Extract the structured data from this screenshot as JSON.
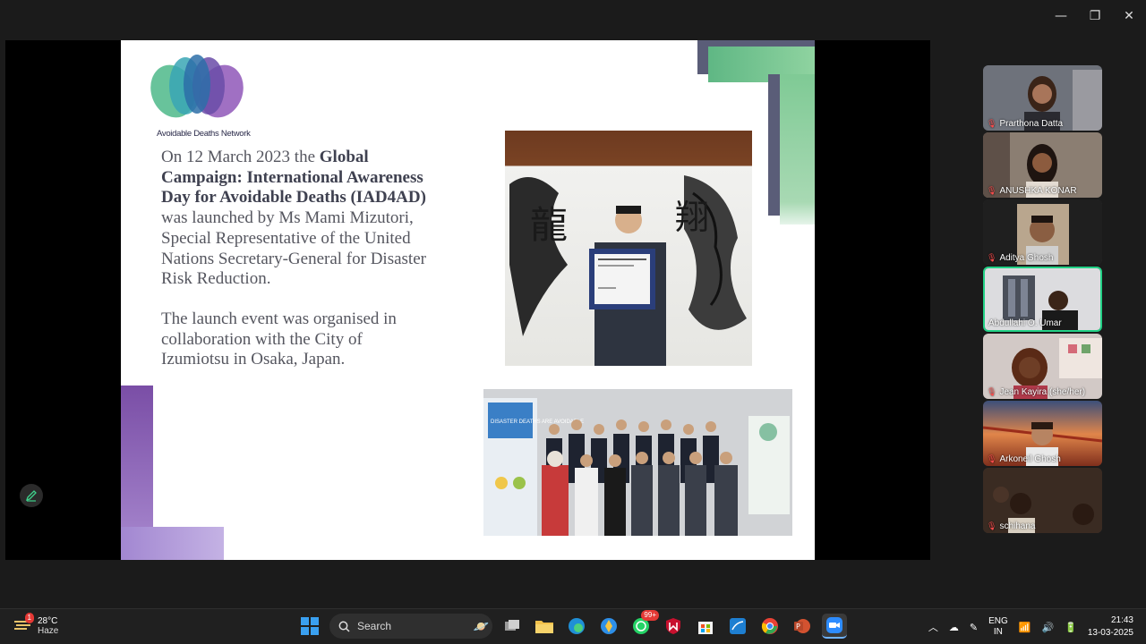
{
  "window": {
    "minimize_glyph": "—",
    "restore_glyph": "❐",
    "close_glyph": "✕"
  },
  "slide": {
    "logo_text": "Avoidable Deaths Network",
    "para1": {
      "prefix": "On 12 March 2023 the ",
      "bold": "Global Campaign: International Awareness Day for Avoidable Deaths (IAD4AD)",
      "suffix": " was launched by Ms Mami Mizutori, Special Representative of the United Nations Secretary-General for Disaster Risk Reduction."
    },
    "para2": "The launch event was organised in collaboration with the City of Izumiotsu in Osaka, Japan.",
    "poster_text": "DISASTER DEATHS ARE AVOIDABLE"
  },
  "participants": [
    {
      "name": "Prarthona Datta",
      "bg": "#6b6f78"
    },
    {
      "name": "ANUSHKA KONAR",
      "bg": "#8a7c70"
    },
    {
      "name": "Aditya Ghosh",
      "bg": "#2c2c2c"
    },
    {
      "name": "Abdullahi O. Umar",
      "bg": "#d9d9dc"
    },
    {
      "name": "Jean Kayira (she/her)",
      "bg": "#cfc6c3"
    },
    {
      "name": "Arkoneil Ghosh",
      "bg": "#c46a3a"
    },
    {
      "name": "schihana",
      "bg": "#3a2a22"
    }
  ],
  "taskbar": {
    "weather": {
      "temp": "28°C",
      "desc": "Haze",
      "badge": "1"
    },
    "search_label": "Search",
    "whatsapp_badge": "99+",
    "lang": {
      "line1": "ENG",
      "line2": "IN"
    },
    "time": "21:43",
    "date": "13-03-2025"
  },
  "colors": {
    "active_speaker": "#22d186",
    "taskbar": "#202020",
    "mic_muted": "#ff4d4d"
  }
}
